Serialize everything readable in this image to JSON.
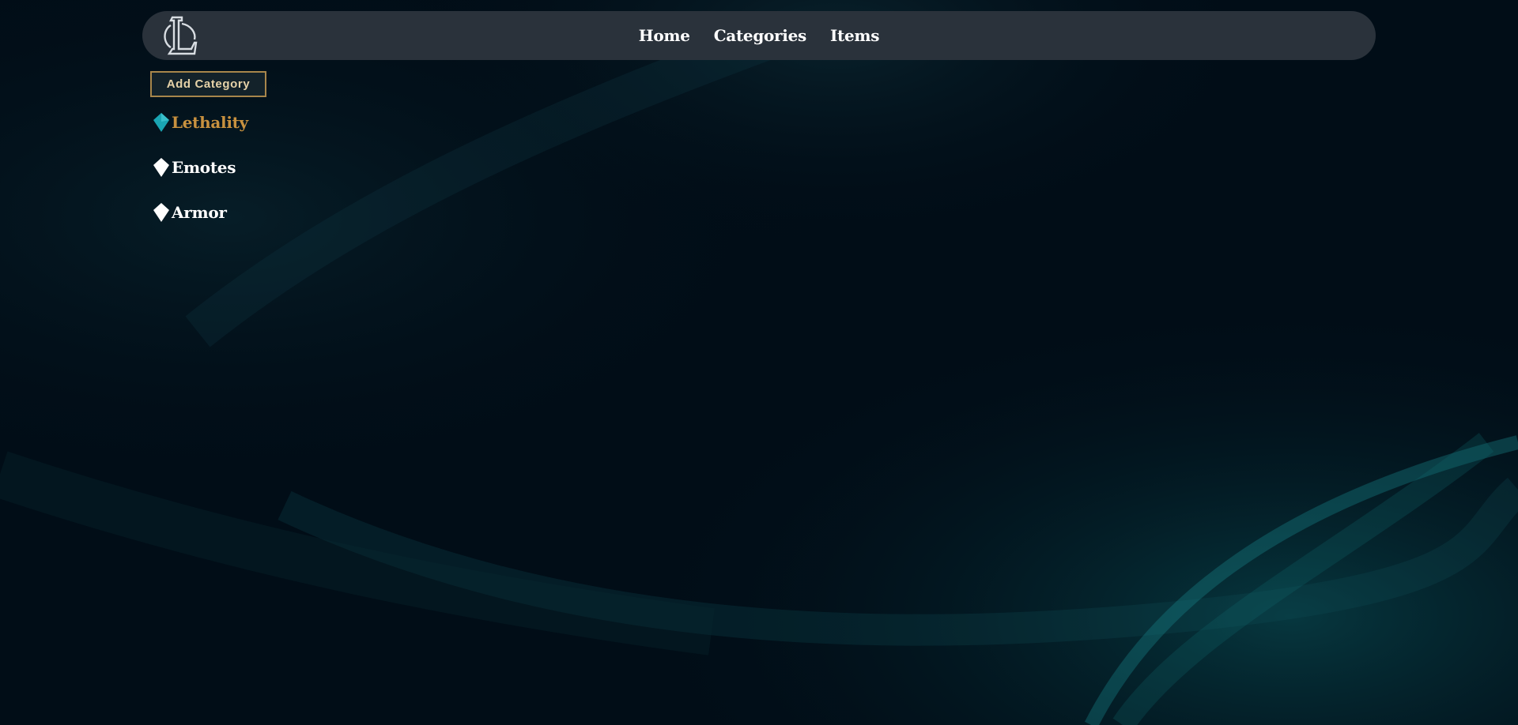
{
  "nav": {
    "logo_icon": "league-of-legends-logo",
    "links": [
      "Home",
      "Categories",
      "Items"
    ]
  },
  "actions": {
    "add_category_label": "Add Category"
  },
  "categories": [
    {
      "label": "Lethality",
      "icon": "diamond-icon",
      "active": true,
      "color": "#c8913f",
      "icon_color": "#1aa5b3"
    },
    {
      "label": "Emotes",
      "icon": "diamond-icon",
      "active": false,
      "color": "#ffffff",
      "icon_color": "#ffffff"
    },
    {
      "label": "Armor",
      "icon": "diamond-icon",
      "active": false,
      "color": "#ffffff",
      "icon_color": "#ffffff"
    }
  ],
  "theme": {
    "background": "#010a13",
    "navbar": "#2a323b",
    "accent_gold": "#c8913f",
    "accent_teal": "#1aa5b3"
  }
}
